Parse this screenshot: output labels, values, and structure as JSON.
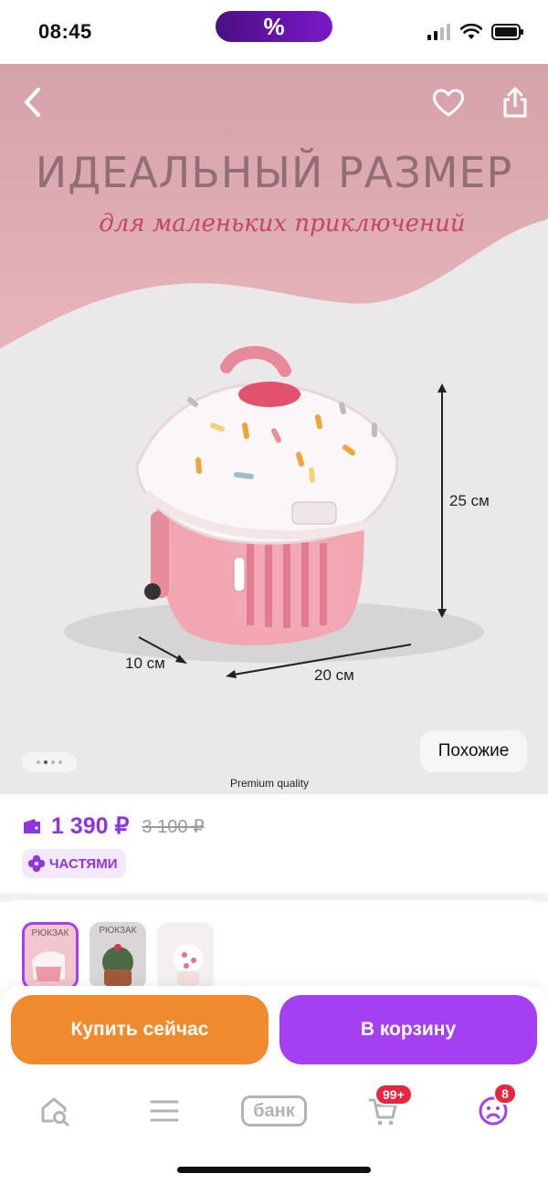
{
  "status_bar": {
    "time": "08:45",
    "promo_symbol": "%",
    "icons": [
      "signal-icon",
      "wifi-icon",
      "battery-icon"
    ]
  },
  "hero": {
    "title": "ИДЕАЛЬНЫЙ РАЗМЕР",
    "subtitle": "для маленьких приключений",
    "dimensions": {
      "height": "25 см",
      "width": "20 см",
      "depth": "10 см"
    },
    "premium_label": "Premium quality",
    "similar_label": "Похожие",
    "pager": {
      "count": 4,
      "active": 1
    },
    "icons": {
      "back": "chevron-left-icon",
      "favorite": "heart-icon",
      "share": "share-icon"
    }
  },
  "price": {
    "current": "1 390 ₽",
    "old": "3 100 ₽",
    "installments_label": "ЧАСТЯМИ",
    "wallet_icon": "wallet-icon"
  },
  "variants": {
    "items": [
      {
        "label": "РЮКЗАК",
        "selected": true,
        "color": "#f1c7cd"
      },
      {
        "label": "РЮКЗАК",
        "selected": false,
        "color": "#d8d6d6"
      },
      {
        "label": "",
        "selected": false,
        "color": "#f4f0f0"
      }
    ]
  },
  "actions": {
    "buy_now": "Купить сейчас",
    "add_to_cart": "В корзину"
  },
  "bottom_nav": {
    "bank_label": "банк",
    "cart_badge": "99+",
    "profile_badge": "8",
    "items": [
      "home-search-icon",
      "catalog-icon",
      "bank-icon",
      "cart-icon",
      "profile-icon"
    ]
  },
  "colors": {
    "accent_purple": "#a43ff2",
    "price_purple": "#8e35e0",
    "buy_orange": "#f08a2e",
    "badge_red": "#e8243f"
  }
}
